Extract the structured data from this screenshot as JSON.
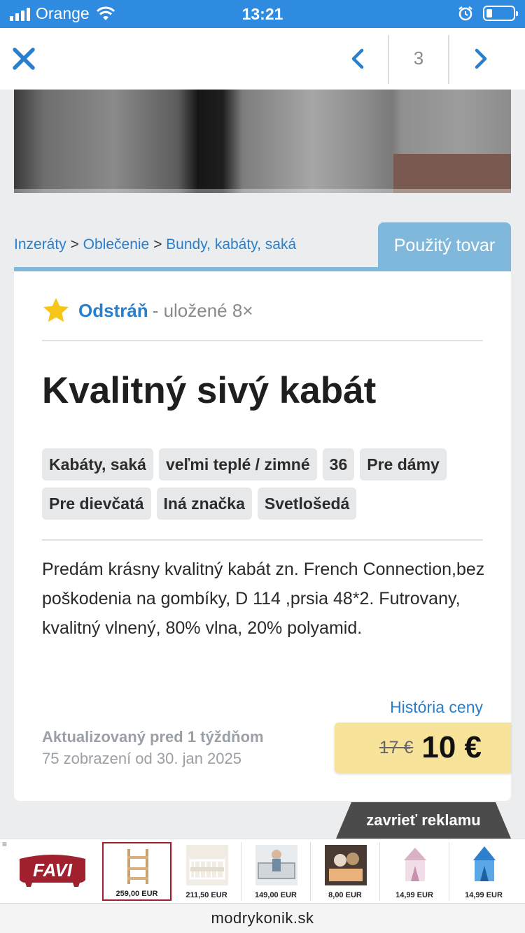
{
  "status_bar": {
    "carrier": "Orange",
    "time": "13:21"
  },
  "nav": {
    "page_number": "3"
  },
  "breadcrumb": {
    "items": [
      "Inzeráty",
      "Oblečenie",
      "Bundy, kabáty, saká"
    ],
    "separator": ">"
  },
  "condition_tab": "Použitý tovar",
  "favorite": {
    "remove_label": "Odstráň",
    "saved_text": "- uložené 8×"
  },
  "listing": {
    "title": "Kvalitný sivý kabát",
    "tags": [
      "Kabáty, saká",
      "veľmi teplé / zimné",
      "36",
      "Pre dámy",
      "Pre dievčatá",
      "Iná značka",
      "Svetlošedá"
    ],
    "description": "Predám krásny kvalitný kabát zn. French Connection,bez poškodenia na gombíky, D 114 ,prsia 48*2. Futrovany, kvalitný vlnený, 80% vlna, 20% polyamid.",
    "price_history_link": "História ceny",
    "updated": "Aktualizovaný pred 1 týždňom",
    "views": "75 zobrazení od 30. jan 2025",
    "old_price": "17 €",
    "price": "10 €"
  },
  "ad": {
    "close_label": "zavrieť reklamu",
    "menu_glyph": "≡",
    "brand_logo": "FAVI",
    "products": [
      {
        "price": "259,00 EUR",
        "icon": "learning-tower-image"
      },
      {
        "price": "211,50 EUR",
        "icon": "crib-image"
      },
      {
        "price": "149,00 EUR",
        "icon": "baby-bed-image"
      },
      {
        "price": "8,00 EUR",
        "icon": "plush-toy-image"
      },
      {
        "price": "14,99 EUR",
        "icon": "pink-tent-image"
      },
      {
        "price": "14,99 EUR",
        "icon": "blue-tent-image"
      }
    ]
  },
  "browser": {
    "domain": "modrykonik.sk"
  },
  "colors": {
    "accent": "#2a7fcc",
    "status_bar": "#2f8be0",
    "tab": "#80b8dc",
    "price_bg": "#f8e39a",
    "star": "#f5c518"
  }
}
